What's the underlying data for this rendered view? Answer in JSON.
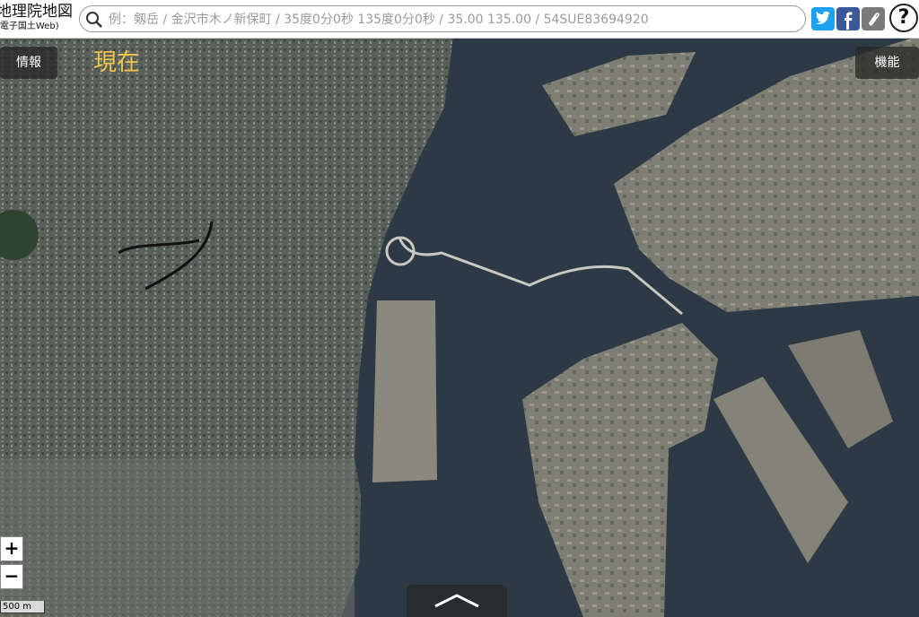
{
  "app": {
    "title": "地理院地図",
    "subtitle": "(電子国土Web)"
  },
  "search": {
    "placeholder": "例：剱岳 / 金沢市木ノ新保町 / 35度0分0秒 135度0分0秒 / 35.00 135.00 / 54SUE83694920"
  },
  "header_actions": [
    {
      "name": "twitter-share-icon",
      "color": "#1da1f2"
    },
    {
      "name": "facebook-share-icon",
      "color": "#3b5998"
    },
    {
      "name": "link-icon",
      "color": "#7a7a7a"
    },
    {
      "name": "help-icon",
      "label": "?"
    }
  ],
  "panels": {
    "info_label": "情報",
    "function_label": "機能"
  },
  "map": {
    "current_location_label": "現在",
    "scale_label": "500 m"
  },
  "zoom": {
    "in_label": "+",
    "out_label": "−"
  },
  "colors": {
    "water": "#2d3a45",
    "land": "#4d5650",
    "reclaimed": "#7b786c",
    "accent": "#f2c44a"
  }
}
